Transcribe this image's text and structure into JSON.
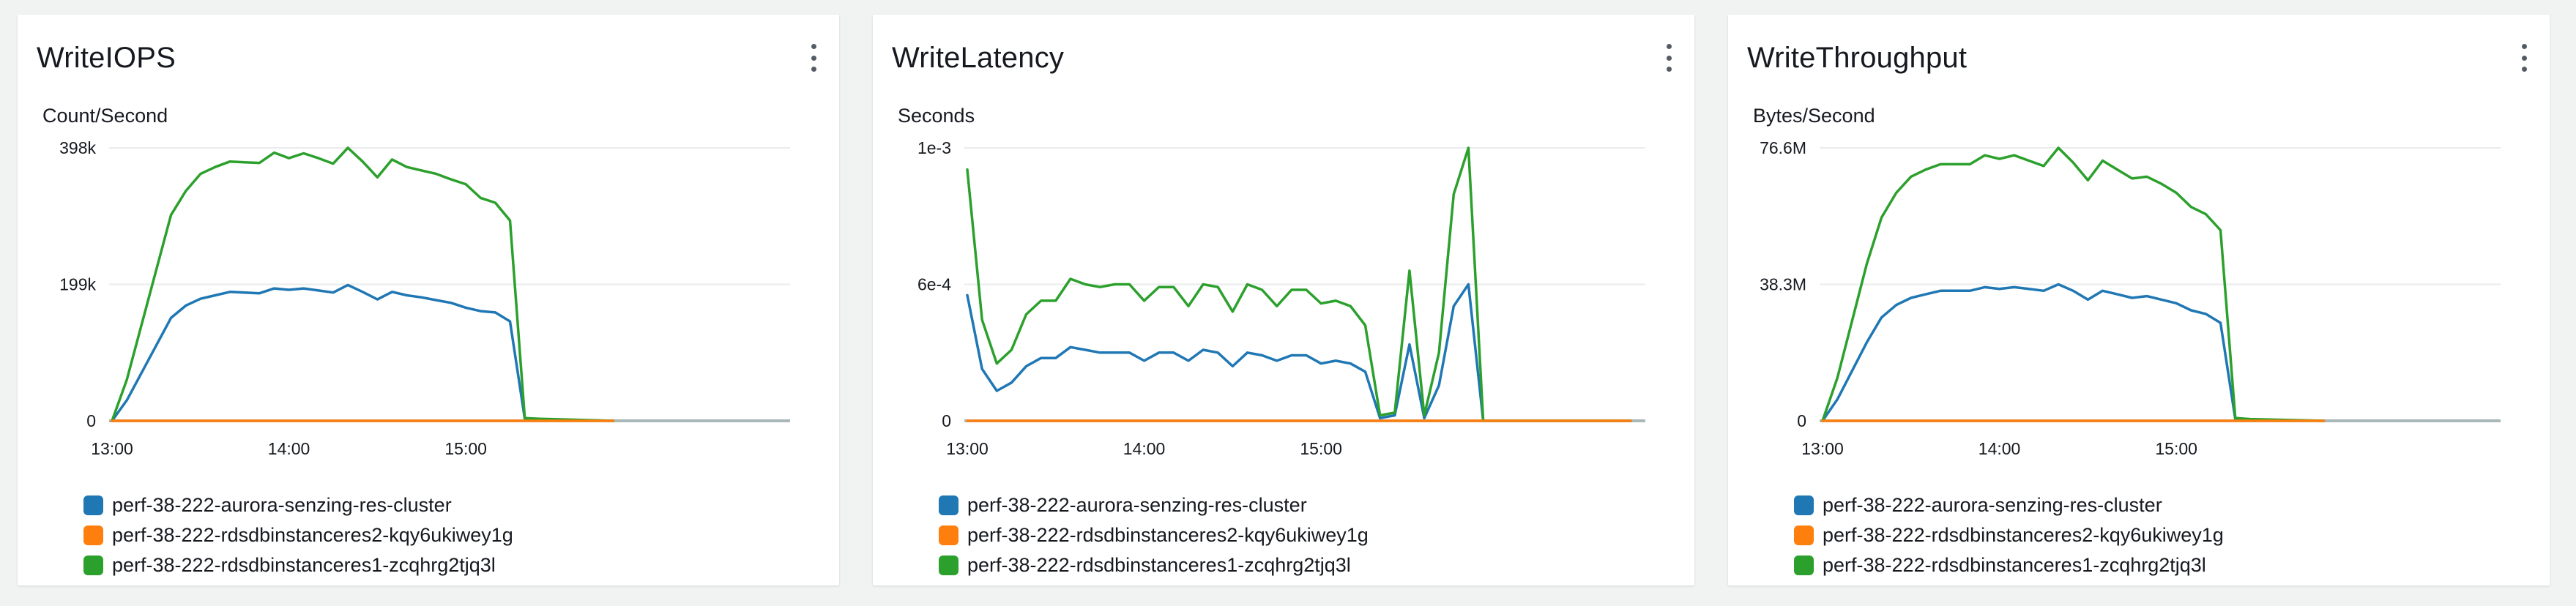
{
  "colors": {
    "series_blue": "#1f77b4",
    "series_orange": "#ff7f0e",
    "series_green": "#2ca02c",
    "gridline": "#e9ebed",
    "axis": "#aab7b8"
  },
  "widgets": [
    {
      "title": "WriteIOPS",
      "menu_icon": "vertical-ellipsis-icon"
    },
    {
      "title": "WriteLatency",
      "menu_icon": "vertical-ellipsis-icon"
    },
    {
      "title": "WriteThroughput",
      "menu_icon": "vertical-ellipsis-icon"
    }
  ],
  "chart_data": [
    {
      "type": "line",
      "title": "WriteIOPS",
      "ylabel": "Count/Second",
      "ylim": [
        0,
        398000
      ],
      "y_tick_values": [
        0,
        199000,
        398000
      ],
      "y_tick_labels": [
        "0",
        "199k",
        "398k"
      ],
      "xlim": [
        "12:59",
        "16:50"
      ],
      "x_tick_values": [
        "13:00",
        "14:00",
        "15:00"
      ],
      "x_tick_labels": [
        "13:00",
        "14:00",
        "15:00"
      ],
      "grid": true,
      "legend_position": "bottom-left",
      "x": [
        "13:00",
        "13:05",
        "13:10",
        "13:15",
        "13:20",
        "13:25",
        "13:30",
        "13:35",
        "13:40",
        "13:45",
        "13:50",
        "13:55",
        "14:00",
        "14:05",
        "14:10",
        "14:15",
        "14:20",
        "14:25",
        "14:30",
        "14:35",
        "14:40",
        "14:45",
        "14:50",
        "14:55",
        "15:00",
        "15:05",
        "15:10",
        "15:15",
        "15:20",
        "15:25",
        "15:50"
      ],
      "series": [
        {
          "name": "perf-38-222-aurora-senzing-res-cluster",
          "color": "#1f77b4",
          "values": [
            0,
            30000,
            70000,
            110000,
            150000,
            168000,
            178000,
            183000,
            188000,
            187000,
            186000,
            193000,
            191000,
            193000,
            190000,
            187000,
            198000,
            188000,
            177000,
            188000,
            183000,
            180000,
            176000,
            172000,
            165000,
            160000,
            158000,
            145000,
            3000,
            2000,
            0
          ]
        },
        {
          "name": "perf-38-222-rdsdbinstanceres2-kqy6ukiwey1g",
          "color": "#ff7f0e",
          "values": [
            0,
            0,
            0,
            0,
            0,
            0,
            0,
            0,
            0,
            0,
            0,
            0,
            0,
            0,
            0,
            0,
            0,
            0,
            0,
            0,
            0,
            0,
            0,
            0,
            0,
            0,
            0,
            0,
            0,
            0,
            0
          ]
        },
        {
          "name": "perf-38-222-rdsdbinstanceres1-zcqhrg2tjq3l",
          "color": "#2ca02c",
          "values": [
            0,
            60000,
            140000,
            220000,
            300000,
            335000,
            360000,
            370000,
            378000,
            377000,
            376000,
            391000,
            383000,
            390000,
            383000,
            375000,
            398000,
            378000,
            355000,
            381000,
            370000,
            365000,
            360000,
            352000,
            345000,
            325000,
            318000,
            292000,
            4000,
            3000,
            0
          ]
        }
      ]
    },
    {
      "type": "line",
      "title": "WriteLatency",
      "ylabel": "Seconds",
      "ylim": [
        0,
        0.001
      ],
      "y_tick_values": [
        0,
        0.0005,
        0.001
      ],
      "y_tick_labels": [
        "0",
        "6e-4",
        "1e-3"
      ],
      "xlim": [
        "12:59",
        "16:50"
      ],
      "x_tick_values": [
        "13:00",
        "14:00",
        "15:00"
      ],
      "x_tick_labels": [
        "13:00",
        "14:00",
        "15:00"
      ],
      "grid": true,
      "legend_position": "bottom-left",
      "x": [
        "13:00",
        "13:05",
        "13:10",
        "13:15",
        "13:20",
        "13:25",
        "13:30",
        "13:35",
        "13:40",
        "13:45",
        "13:50",
        "13:55",
        "14:00",
        "14:05",
        "14:10",
        "14:15",
        "14:20",
        "14:25",
        "14:30",
        "14:35",
        "14:40",
        "14:45",
        "14:50",
        "14:55",
        "15:00",
        "15:05",
        "15:10",
        "15:15",
        "15:20",
        "15:25",
        "15:30",
        "15:35",
        "15:40",
        "15:45",
        "15:50",
        "15:55",
        "16:00",
        "16:05",
        "16:10",
        "16:15",
        "16:20",
        "16:25",
        "16:30",
        "16:35",
        "16:40",
        "16:45"
      ],
      "series": [
        {
          "name": "perf-38-222-aurora-senzing-res-cluster",
          "color": "#1f77b4",
          "values": [
            0.00046,
            0.00019,
            0.00011,
            0.00014,
            0.0002,
            0.00023,
            0.00023,
            0.00027,
            0.00026,
            0.00025,
            0.00025,
            0.00025,
            0.00022,
            0.00025,
            0.00025,
            0.00022,
            0.00026,
            0.00025,
            0.0002,
            0.00025,
            0.00024,
            0.00022,
            0.00024,
            0.00024,
            0.00021,
            0.00022,
            0.00021,
            0.00018,
            1e-05,
            2e-05,
            0.00028,
            1e-05,
            0.00013,
            0.00042,
            0.0005,
            0,
            0,
            0,
            0,
            0,
            0,
            0,
            0,
            0,
            0,
            0
          ]
        },
        {
          "name": "perf-38-222-rdsdbinstanceres2-kqy6ukiwey1g",
          "color": "#ff7f0e",
          "values": [
            0,
            0,
            0,
            0,
            0,
            0,
            0,
            0,
            0,
            0,
            0,
            0,
            0,
            0,
            0,
            0,
            0,
            0,
            0,
            0,
            0,
            0,
            0,
            0,
            0,
            0,
            0,
            0,
            0,
            0,
            0,
            0,
            0,
            0,
            0,
            0,
            0,
            0,
            0,
            0,
            0,
            0,
            0,
            0,
            0,
            0
          ]
        },
        {
          "name": "perf-38-222-rdsdbinstanceres1-zcqhrg2tjq3l",
          "color": "#2ca02c",
          "values": [
            0.00092,
            0.00037,
            0.00021,
            0.00026,
            0.00039,
            0.00044,
            0.00044,
            0.00052,
            0.0005,
            0.00049,
            0.0005,
            0.0005,
            0.00044,
            0.00049,
            0.00049,
            0.00042,
            0.0005,
            0.00049,
            0.0004,
            0.0005,
            0.00048,
            0.00042,
            0.00048,
            0.00048,
            0.00043,
            0.00044,
            0.00042,
            0.00035,
            2e-05,
            3e-05,
            0.00055,
            2e-05,
            0.00025,
            0.00083,
            0.001,
            0,
            0,
            0,
            0,
            0,
            0,
            0,
            0,
            0,
            0,
            0
          ]
        }
      ]
    },
    {
      "type": "line",
      "title": "WriteThroughput",
      "ylabel": "Bytes/Second",
      "ylim": [
        0,
        76600000
      ],
      "y_tick_values": [
        0,
        38300000,
        76600000
      ],
      "y_tick_labels": [
        "0",
        "38.3M",
        "76.6M"
      ],
      "xlim": [
        "12:59",
        "16:50"
      ],
      "x_tick_values": [
        "13:00",
        "14:00",
        "15:00"
      ],
      "x_tick_labels": [
        "13:00",
        "14:00",
        "15:00"
      ],
      "grid": true,
      "legend_position": "bottom-left",
      "x": [
        "13:00",
        "13:05",
        "13:10",
        "13:15",
        "13:20",
        "13:25",
        "13:30",
        "13:35",
        "13:40",
        "13:45",
        "13:50",
        "13:55",
        "14:00",
        "14:05",
        "14:10",
        "14:15",
        "14:20",
        "14:25",
        "14:30",
        "14:35",
        "14:40",
        "14:45",
        "14:50",
        "14:55",
        "15:00",
        "15:05",
        "15:10",
        "15:15",
        "15:20",
        "15:25",
        "15:50"
      ],
      "series": [
        {
          "name": "perf-38-222-aurora-senzing-res-cluster",
          "color": "#1f77b4",
          "values": [
            0,
            6000000,
            14000000,
            22000000,
            29000000,
            32500000,
            34500000,
            35500000,
            36500000,
            36500000,
            36500000,
            37500000,
            37000000,
            37500000,
            37000000,
            36500000,
            38300000,
            36500000,
            34000000,
            36500000,
            35500000,
            34500000,
            35000000,
            34000000,
            33000000,
            31000000,
            30000000,
            27500000,
            500000,
            300000,
            0
          ]
        },
        {
          "name": "perf-38-222-rdsdbinstanceres2-kqy6ukiwey1g",
          "color": "#ff7f0e",
          "values": [
            0,
            0,
            0,
            0,
            0,
            0,
            0,
            0,
            0,
            0,
            0,
            0,
            0,
            0,
            0,
            0,
            0,
            0,
            0,
            0,
            0,
            0,
            0,
            0,
            0,
            0,
            0,
            0,
            0,
            0,
            0
          ]
        },
        {
          "name": "perf-38-222-rdsdbinstanceres1-zcqhrg2tjq3l",
          "color": "#2ca02c",
          "values": [
            0,
            12000000,
            28000000,
            44000000,
            57000000,
            64000000,
            68500000,
            70500000,
            72000000,
            72000000,
            72000000,
            74500000,
            73500000,
            74500000,
            73000000,
            71500000,
            76600000,
            72500000,
            67500000,
            73000000,
            70500000,
            68000000,
            68500000,
            66500000,
            64000000,
            60000000,
            58000000,
            53500000,
            800000,
            500000,
            0
          ]
        }
      ]
    }
  ]
}
